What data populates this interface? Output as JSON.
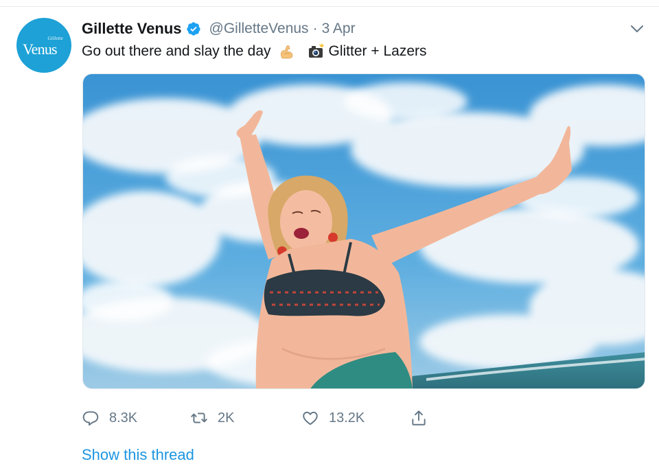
{
  "tweet": {
    "avatar_brand_small": "Gillette",
    "avatar_brand_main": "Venus",
    "display_name": "Gillette Venus",
    "handle": "@GilletteVenus",
    "separator": "·",
    "date": "3 Apr",
    "text_before_emoji": "Go out there and slay the day",
    "emoji_icons": [
      "flexed-biceps-icon",
      "camera-flash-icon"
    ],
    "text_after_emoji": "Glitter + Lazers",
    "media_description_icon": "photo-woman-bikini-sky"
  },
  "actions": {
    "reply_count": "8.3K",
    "retweet_count": "2K",
    "like_count": "13.2K"
  },
  "thread_link": "Show this thread",
  "colors": {
    "accent": "#1b95e0",
    "verified": "#1da1f2",
    "muted": "#657786",
    "avatar_bg": "#1da1d6"
  }
}
